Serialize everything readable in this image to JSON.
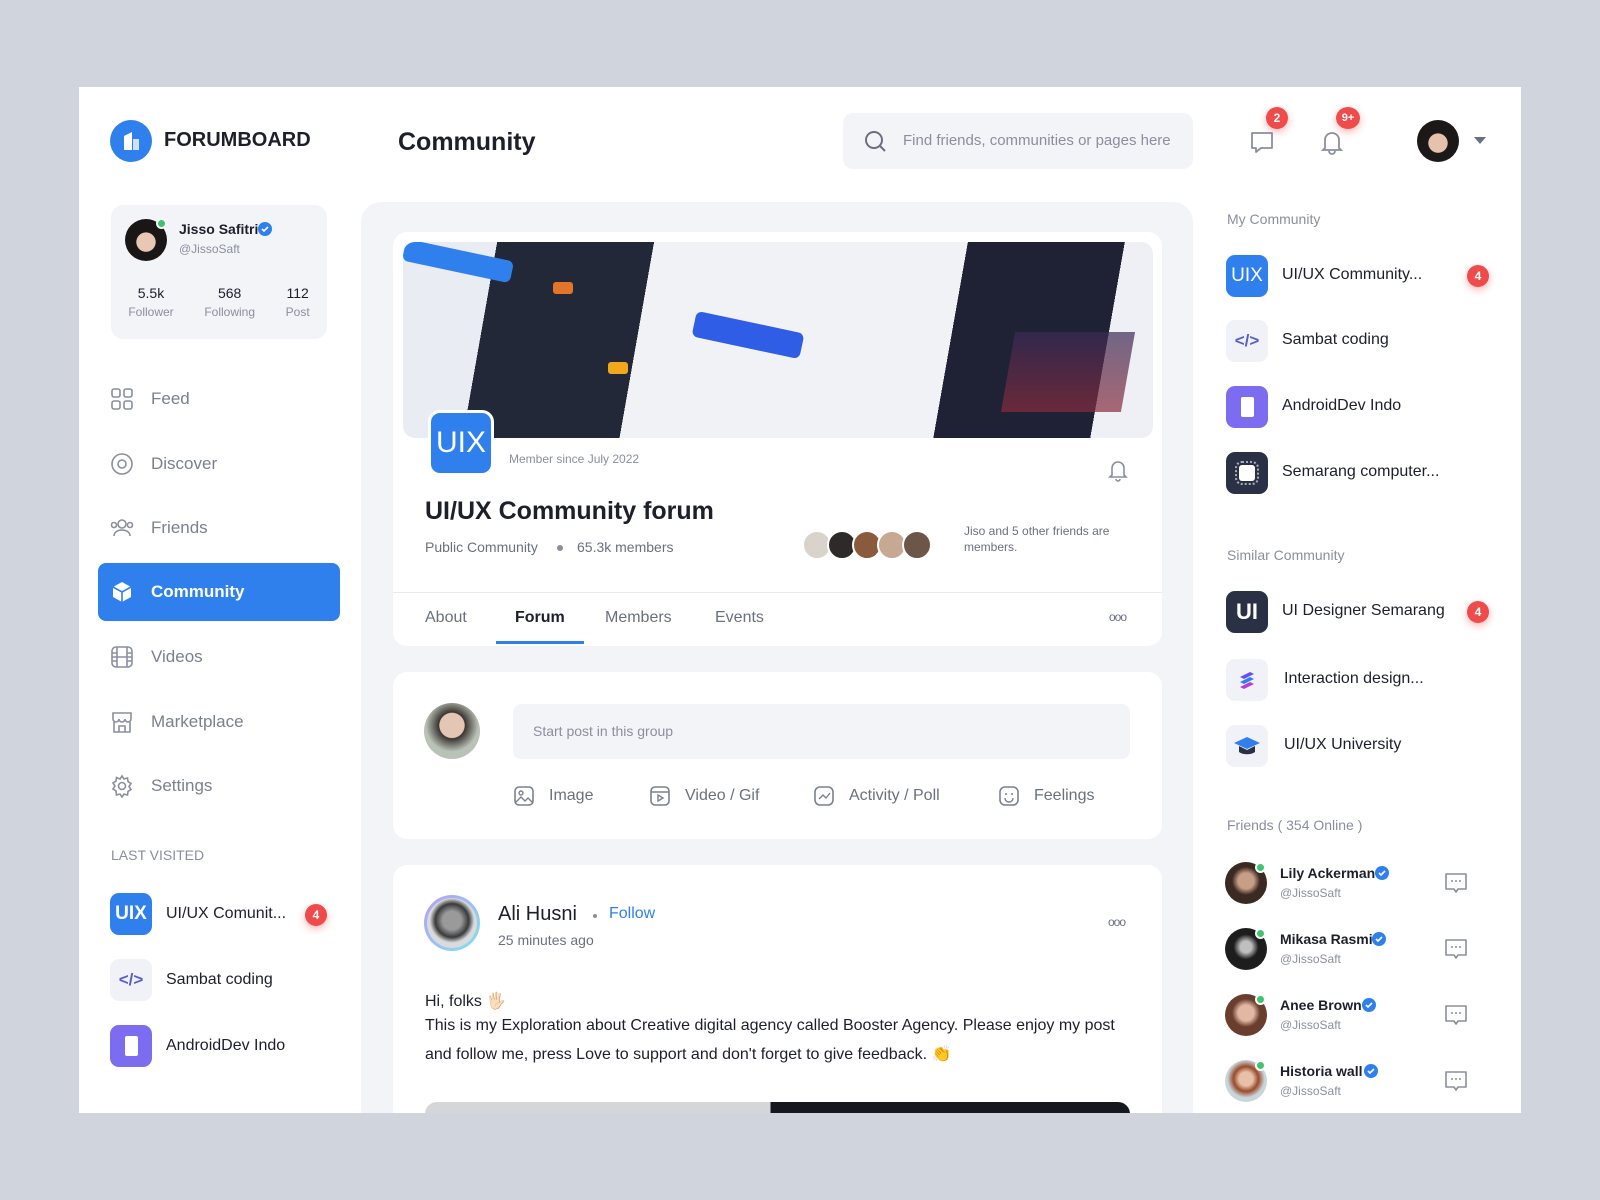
{
  "brand": {
    "name": "FORUMBOARD",
    "color": "#2f80ed"
  },
  "header": {
    "title": "Community",
    "search_placeholder": "Find friends, communities or pages here",
    "messages_badge": "2",
    "notifications_badge": "9+"
  },
  "profile": {
    "name": "Jisso Safitri",
    "handle": "@JissoSaft",
    "stats": [
      {
        "value": "5.5k",
        "label": "Follower"
      },
      {
        "value": "568",
        "label": "Following"
      },
      {
        "value": "112",
        "label": "Post"
      }
    ]
  },
  "nav": [
    {
      "label": "Feed",
      "icon": "grid-icon"
    },
    {
      "label": "Discover",
      "icon": "compass-icon"
    },
    {
      "label": "Friends",
      "icon": "users-icon"
    },
    {
      "label": "Community",
      "icon": "cube-icon",
      "active": true
    },
    {
      "label": "Videos",
      "icon": "film-icon"
    },
    {
      "label": "Marketplace",
      "icon": "store-icon"
    },
    {
      "label": "Settings",
      "icon": "gear-icon"
    }
  ],
  "last_visited": {
    "title": "LAST VISITED",
    "items": [
      {
        "name": "UI/UX Comunit...",
        "badge": "4"
      },
      {
        "name": "Sambat coding"
      },
      {
        "name": "AndroidDev Indo"
      }
    ]
  },
  "community": {
    "logo": "UIX",
    "member_since": "Member since July 2022",
    "title": "UI/UX Community forum",
    "type": "Public Community",
    "members": "65.3k members",
    "friends_text": "Jiso and 5 other friends are members.",
    "tabs": [
      "About",
      "Forum",
      "Members",
      "Events"
    ],
    "active_tab": "Forum"
  },
  "composer": {
    "placeholder": "Start post in this group",
    "actions": [
      "Image",
      "Video / Gif",
      "Activity / Poll",
      "Feelings"
    ]
  },
  "post": {
    "author": "Ali Husni",
    "follow": "Follow",
    "time": "25 minutes ago",
    "line1": "Hi, folks 🖐🏻",
    "body": "This is my Exploration about Creative digital agency called Booster Agency. Please enjoy my post and follow me, press Love to support and don't forget to give feedback. 👏"
  },
  "my_community": {
    "title": "My Community",
    "items": [
      {
        "name": "UI/UX Community...",
        "logo": "UIX",
        "badge": "4"
      },
      {
        "name": "Sambat coding"
      },
      {
        "name": "AndroidDev Indo"
      },
      {
        "name": "Semarang computer..."
      }
    ]
  },
  "similar_community": {
    "title": "Similar Community",
    "items": [
      {
        "name": "UI Designer Semarang",
        "logo": "UI",
        "badge": "4"
      },
      {
        "name": "Interaction design..."
      },
      {
        "name": "UI/UX University"
      }
    ]
  },
  "friends": {
    "title": "Friends ( 354 Online )",
    "items": [
      {
        "name": "Lily Ackerman",
        "handle": "@JissoSaft"
      },
      {
        "name": "Mikasa Rasmi",
        "handle": "@JissoSaft"
      },
      {
        "name": "Anee Brown",
        "handle": "@JissoSaft"
      },
      {
        "name": "Historia wall",
        "handle": "@JissoSaft"
      }
    ]
  }
}
